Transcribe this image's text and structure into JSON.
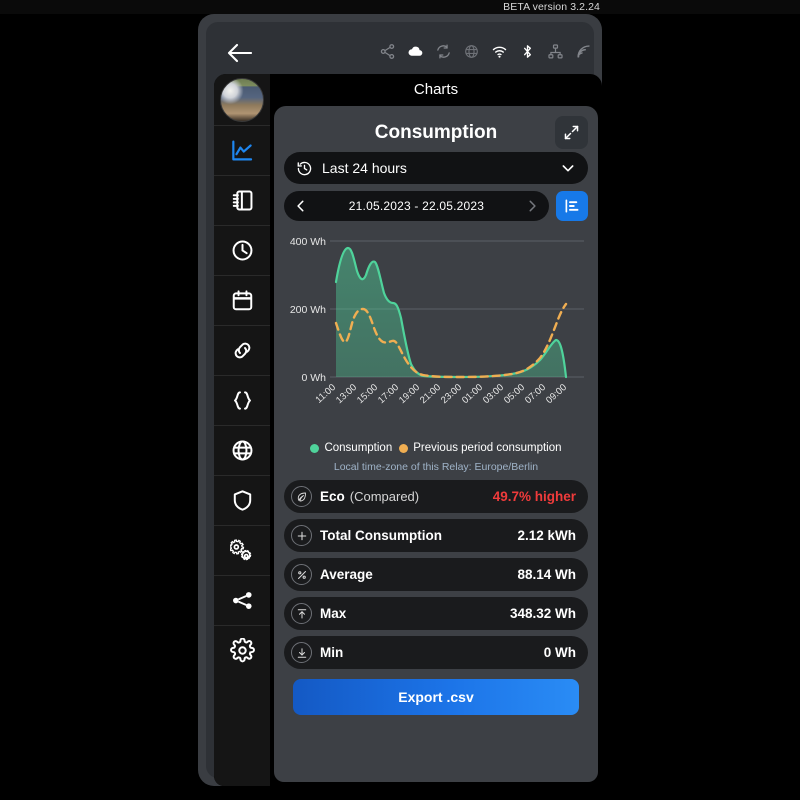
{
  "beta_banner": {
    "text": "BETA version 3.2.24"
  },
  "statusbar": {
    "back_icon": "back-arrow-icon",
    "icons": [
      {
        "name": "share-nodes-icon",
        "active": false
      },
      {
        "name": "cloud-icon",
        "active": true
      },
      {
        "name": "sync-icon",
        "active": false
      },
      {
        "name": "globe-icon",
        "active": false
      },
      {
        "name": "wifi-icon",
        "active": true
      },
      {
        "name": "bluetooth-icon",
        "active": true
      },
      {
        "name": "network-icon",
        "active": false
      },
      {
        "name": "signal-icon",
        "active": false
      }
    ]
  },
  "sidebar": {
    "avatar": "user-avatar",
    "items": [
      {
        "icon": "line-chart-icon",
        "name": "sidebar-item-charts",
        "active": true
      },
      {
        "icon": "notebook-icon",
        "name": "sidebar-item-logbook",
        "active": false
      },
      {
        "icon": "clock-icon",
        "name": "sidebar-item-schedule",
        "active": false
      },
      {
        "icon": "calendar-icon",
        "name": "sidebar-item-calendar",
        "active": false
      },
      {
        "icon": "link-icon",
        "name": "sidebar-item-links",
        "active": false
      },
      {
        "icon": "braces-icon",
        "name": "sidebar-item-code",
        "active": false
      },
      {
        "icon": "globe-icon",
        "name": "sidebar-item-network",
        "active": false
      },
      {
        "icon": "shield-icon",
        "name": "sidebar-item-security",
        "active": false
      },
      {
        "icon": "gears-icon",
        "name": "sidebar-item-automation",
        "active": false
      },
      {
        "icon": "share-icon",
        "name": "sidebar-item-share",
        "active": false
      },
      {
        "icon": "gear-icon",
        "name": "sidebar-item-settings",
        "active": false
      }
    ]
  },
  "page": {
    "title": "Charts"
  },
  "panel": {
    "title": "Consumption",
    "expand_icon": "expand-arrows-icon",
    "range_select": {
      "icon": "history-icon",
      "value": "Last 24 hours",
      "chevron": "chevron-down-icon"
    },
    "date_nav": {
      "prev_icon": "chevron-left-icon",
      "next_icon": "chevron-right-icon",
      "range": "21.05.2023 - 22.05.2023"
    },
    "chart_type_button": {
      "icon": "bar-chart-icon",
      "color": "#1779e8"
    }
  },
  "legend": [
    {
      "label": "Consumption",
      "color": "#4fd39b"
    },
    {
      "label": "Previous period consumption",
      "color": "#f0ae52"
    }
  ],
  "timezone_note": "Local time-zone of this Relay: Europe/Berlin",
  "stats": [
    {
      "icon": "leaf-icon",
      "label": "Eco",
      "sub": "(Compared)",
      "value": "49.7% higher",
      "alert": true
    },
    {
      "icon": "plus-icon",
      "label": "Total Consumption",
      "sub": "",
      "value": "2.12 kWh",
      "alert": false
    },
    {
      "icon": "percent-icon",
      "label": "Average",
      "sub": "",
      "value": "88.14 Wh",
      "alert": false
    },
    {
      "icon": "arrow-up-icon",
      "label": "Max",
      "sub": "",
      "value": "348.32 Wh",
      "alert": false
    },
    {
      "icon": "arrow-down-icon",
      "label": "Min",
      "sub": "",
      "value": "0 Wh",
      "alert": false
    }
  ],
  "export_button": {
    "label": "Export .csv"
  },
  "chart_data": {
    "type": "area",
    "title": "Consumption",
    "xlabel": "",
    "ylabel": "Wh",
    "ylim": [
      0,
      400
    ],
    "ytick_labels": [
      "0 Wh",
      "200 Wh",
      "400 Wh"
    ],
    "yticks": [
      0,
      200,
      400
    ],
    "grid": true,
    "legend_position": "bottom",
    "x": [
      "11:00",
      "12:00",
      "13:00",
      "14:00",
      "15:00",
      "16:00",
      "17:00",
      "18:00",
      "19:00",
      "20:00",
      "21:00",
      "22:00",
      "23:00",
      "00:00",
      "01:00",
      "02:00",
      "03:00",
      "04:00",
      "05:00",
      "06:00",
      "07:00",
      "08:00",
      "09:00",
      "10:00"
    ],
    "xtick_labels": [
      "11:00",
      "13:00",
      "15:00",
      "17:00",
      "19:00",
      "21:00",
      "23:00",
      "01:00",
      "03:00",
      "05:00",
      "07:00",
      "09:00"
    ],
    "series": [
      {
        "name": "Consumption",
        "color": "#4fd39b",
        "style": "solid-area",
        "values": [
          280,
          348,
          300,
          322,
          255,
          215,
          212,
          150,
          60,
          22,
          10,
          5,
          3,
          2,
          2,
          2,
          2,
          3,
          5,
          12,
          30,
          62,
          110,
          0
        ]
      },
      {
        "name": "Previous period consumption",
        "color": "#f0ae52",
        "style": "dashed-line",
        "values": [
          160,
          120,
          175,
          205,
          188,
          140,
          118,
          120,
          70,
          30,
          18,
          10,
          6,
          4,
          3,
          3,
          3,
          4,
          7,
          16,
          38,
          78,
          140,
          200
        ]
      }
    ]
  }
}
